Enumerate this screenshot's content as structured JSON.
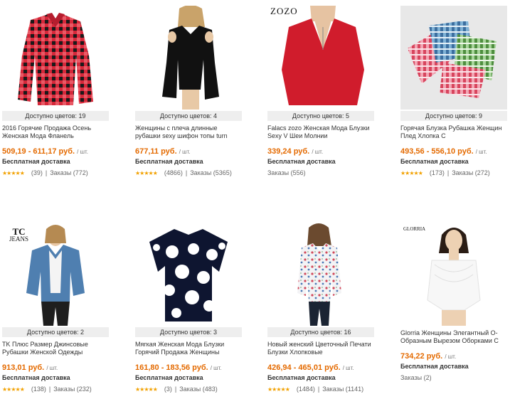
{
  "products": [
    {
      "colors": "Доступно цветов: 19",
      "title": "2016 Горячие Продажа Осень Женская Мода Фланель",
      "price": "509,19 - 611,17 руб.",
      "unit": "/ шт.",
      "shipping": "Бесплатная доставка",
      "reviews": "(39)",
      "orders": "Заказы (772)",
      "stars": "★★★★★"
    },
    {
      "colors": "Доступно цветов: 4",
      "title": "Женщины с плеча длинные рубашки sexy шифон топы turn",
      "price": "677,11 руб.",
      "unit": "/ шт.",
      "shipping": "Бесплатная доставка",
      "reviews": "(4866)",
      "orders": "Заказы (5365)",
      "stars": "★★★★★"
    },
    {
      "colors": "Доступно цветов: 5",
      "title": "Falacs zozo Женская Мода Блузки Sexy V Шеи Молнии",
      "price": "339,24 руб.",
      "unit": "/ шт.",
      "shipping": "Бесплатная доставка",
      "reviews": "",
      "orders": "Заказы (556)",
      "stars": "",
      "brand": "ZOZO"
    },
    {
      "colors": "Доступно цветов: 9",
      "title": "Горячая Блузка Рубашка Женщин Плед Хлопка С",
      "price": "493,56 - 556,10 руб.",
      "unit": "/ шт.",
      "shipping": "Бесплатная доставка",
      "reviews": "(173)",
      "orders": "Заказы (272)",
      "stars": "★★★★★"
    },
    {
      "colors": "Доступно цветов: 2",
      "title": "TK Плюс Размер Джинсовые Рубашки Женской Одежды",
      "price": "913,01 руб.",
      "unit": "/ шт.",
      "shipping": "Бесплатная доставка",
      "reviews": "(138)",
      "orders": "Заказы (232)",
      "stars": "★★★★★",
      "brand": "TC",
      "brand2": "JEANS"
    },
    {
      "colors": "Доступно цветов: 3",
      "title": "Мягкая Женская Мода Блузки Горячий Продажа Женщины",
      "price": "161,80 - 183,56 руб.",
      "unit": "/ шт.",
      "shipping": "Бесплатная доставка",
      "reviews": "(3)",
      "orders": "Заказы (483)",
      "stars": "★★★★★"
    },
    {
      "colors": "Доступно цветов: 16",
      "title": "Новый женский Цветочный Печати Блузки Хлопковые",
      "price": "426,94 - 465,01 руб.",
      "unit": "/ шт.",
      "shipping": "Бесплатная доставка",
      "reviews": "(1484)",
      "orders": "Заказы (1141)",
      "stars": "★★★★★"
    },
    {
      "colors": "",
      "title": "Glorria Женщины Элегантный O-Образным Вырезом Оборками С",
      "price": "734,22 руб.",
      "unit": "/ шт.",
      "shipping": "Бесплатная доставка",
      "reviews": "",
      "orders": "Заказы (2)",
      "stars": "",
      "brand": "GLORRIA"
    }
  ],
  "colors": {
    "price": "#e46a00",
    "star": "#f2a100",
    "bar": "#eeeeee"
  }
}
